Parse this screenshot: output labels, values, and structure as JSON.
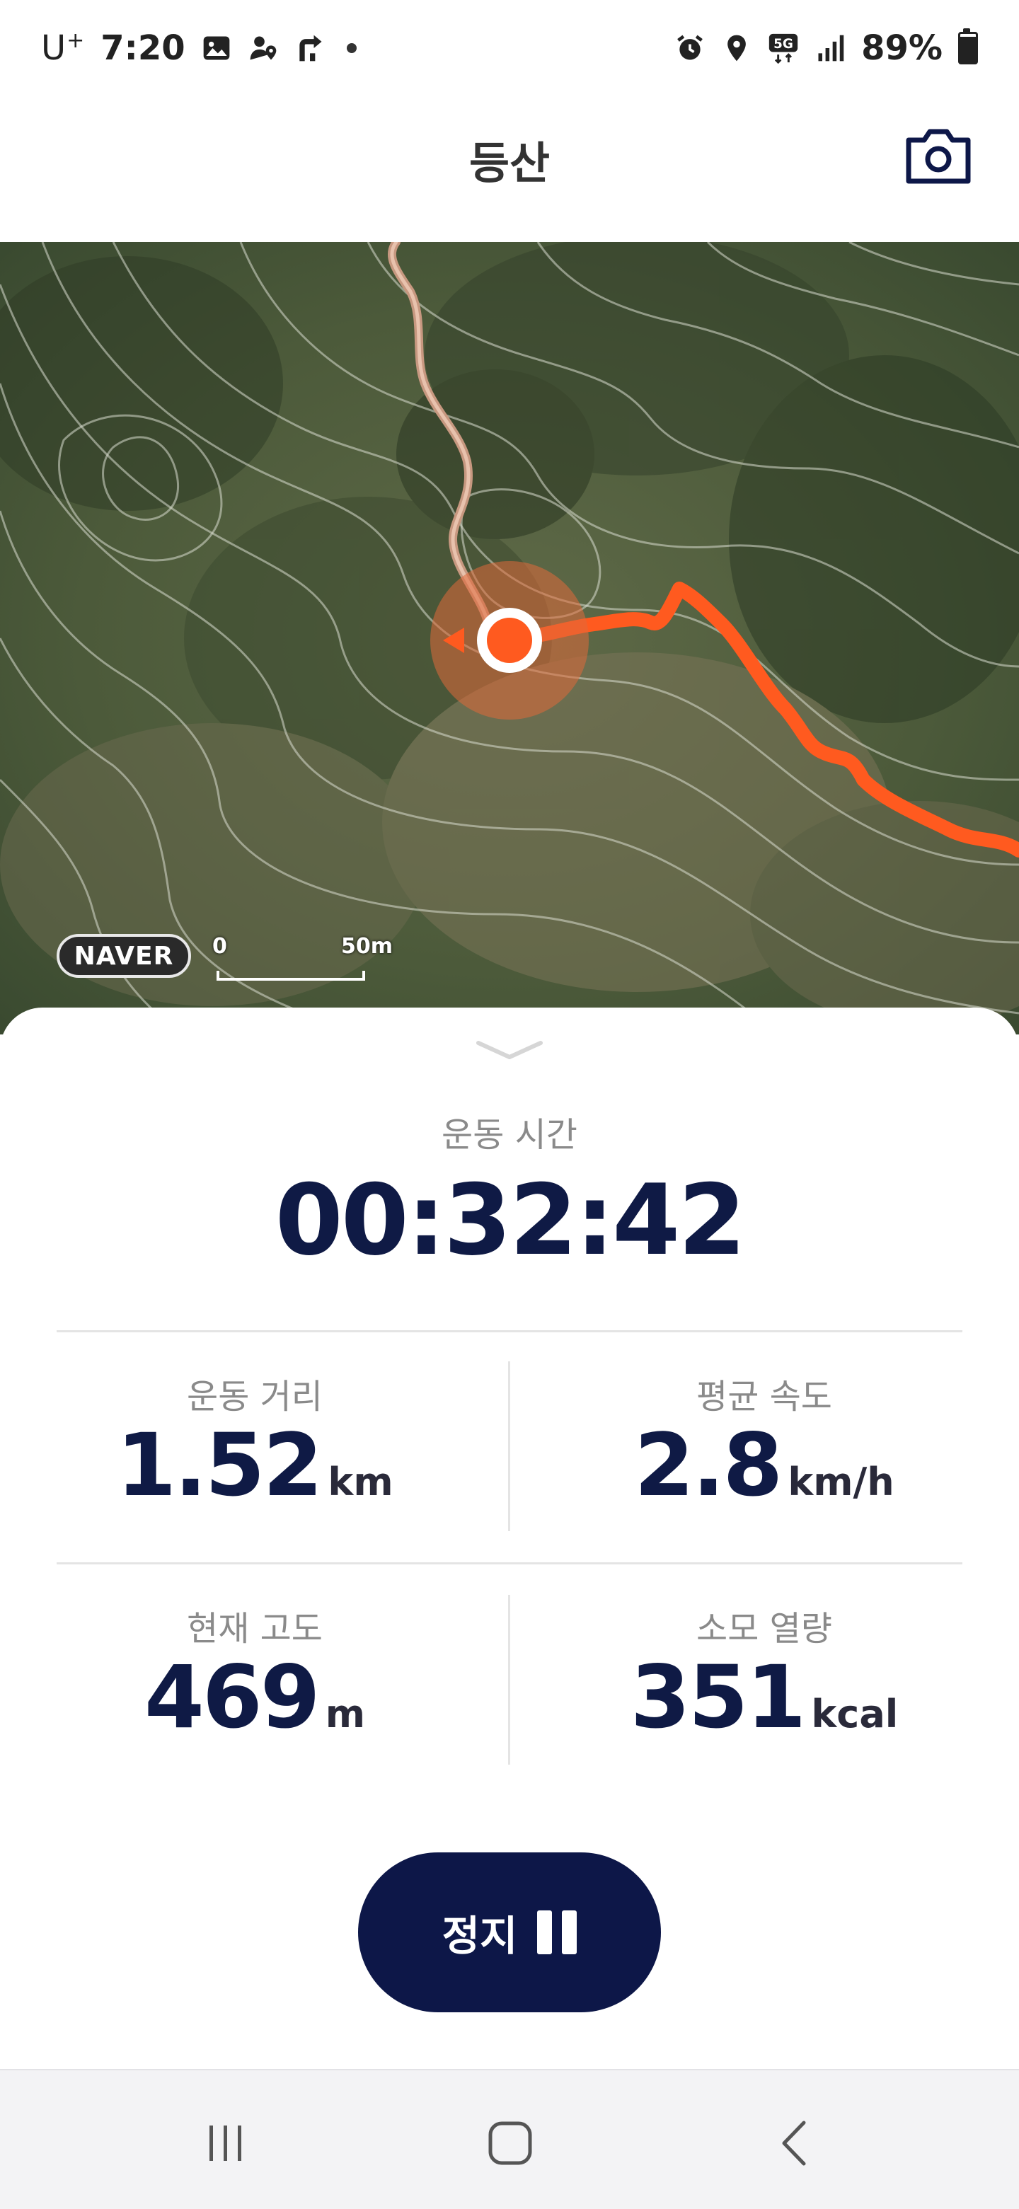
{
  "status_bar": {
    "carrier": "U",
    "carrier_sup": "+",
    "time": "7:20",
    "network": "5G",
    "battery_percent": "89%",
    "battery_level": 0.89,
    "left_icons": [
      "gallery-icon",
      "person-location-icon",
      "directions-icon",
      "dot-icon"
    ],
    "right_icons": [
      "alarm-icon",
      "location-pin-icon",
      "5g-icon",
      "signal-icon",
      "battery-icon"
    ]
  },
  "header": {
    "title": "등산",
    "camera_icon": "camera-icon"
  },
  "map": {
    "provider": "NAVER",
    "scale_start": "0",
    "scale_end": "50m",
    "colors": {
      "route_active": "#ff5a1f",
      "route_past": "#d9a08a",
      "accent": "#ff5a1f"
    }
  },
  "workout": {
    "duration_label": "운동 시간",
    "duration_value": "00:32:42",
    "stats": [
      {
        "label": "운동 거리",
        "value": "1.52",
        "unit": "km"
      },
      {
        "label": "평균 속도",
        "value": "2.8",
        "unit": "km/h"
      },
      {
        "label": "현재 고도",
        "value": "469",
        "unit": "m"
      },
      {
        "label": "소모 열량",
        "value": "351",
        "unit": "kcal"
      }
    ],
    "stop_label": "정지"
  },
  "colors": {
    "primary": "#0d1748",
    "value_text": "#0f1a45",
    "label_text": "#8a8a8a"
  },
  "nav_bar": {
    "icons": [
      "recent-apps-icon",
      "home-icon",
      "back-icon"
    ]
  }
}
